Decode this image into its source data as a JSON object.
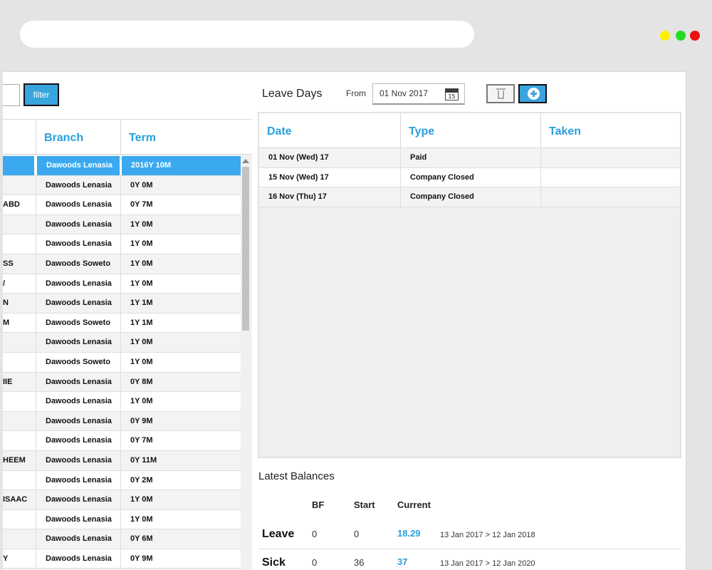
{
  "window": {
    "controls": [
      "minimize",
      "maximize",
      "close"
    ]
  },
  "filter": {
    "button_label": "filter",
    "search_value": ""
  },
  "employee_grid": {
    "headers": [
      "",
      "Branch",
      "Term"
    ],
    "rows": [
      {
        "name": "",
        "branch": "Dawoods Lenasia",
        "term": "2016Y 10M",
        "selected": true
      },
      {
        "name": "",
        "branch": "Dawoods Lenasia",
        "term": "0Y 0M"
      },
      {
        "name": "ABD",
        "branch": "Dawoods Lenasia",
        "term": "0Y 7M"
      },
      {
        "name": "",
        "branch": "Dawoods Lenasia",
        "term": "1Y 0M"
      },
      {
        "name": "",
        "branch": "Dawoods Lenasia",
        "term": "1Y 0M"
      },
      {
        "name": "SS",
        "branch": "Dawoods Soweto",
        "term": "1Y 0M"
      },
      {
        "name": "/",
        "branch": "Dawoods Lenasia",
        "term": "1Y 0M"
      },
      {
        "name": "N",
        "branch": "Dawoods Lenasia",
        "term": "1Y 1M"
      },
      {
        "name": "M",
        "branch": "Dawoods Soweto",
        "term": "1Y 1M"
      },
      {
        "name": "",
        "branch": "Dawoods Lenasia",
        "term": "1Y 0M"
      },
      {
        "name": "",
        "branch": "Dawoods Soweto",
        "term": "1Y 0M"
      },
      {
        "name": "IIE",
        "branch": "Dawoods Lenasia",
        "term": "0Y 8M"
      },
      {
        "name": "",
        "branch": "Dawoods Lenasia",
        "term": "1Y 0M"
      },
      {
        "name": "",
        "branch": "Dawoods Lenasia",
        "term": "0Y 9M"
      },
      {
        "name": "",
        "branch": "Dawoods Lenasia",
        "term": "0Y 7M"
      },
      {
        "name": "HEEM",
        "branch": "Dawoods Lenasia",
        "term": "0Y 11M"
      },
      {
        "name": "",
        "branch": "Dawoods Lenasia",
        "term": "0Y 2M"
      },
      {
        "name": "ISAAC",
        "branch": "Dawoods Lenasia",
        "term": "1Y 0M"
      },
      {
        "name": "",
        "branch": "Dawoods Lenasia",
        "term": "1Y 0M"
      },
      {
        "name": "",
        "branch": "Dawoods Lenasia",
        "term": "0Y 6M"
      },
      {
        "name": "Y",
        "branch": "Dawoods Lenasia",
        "term": "0Y 9M"
      }
    ]
  },
  "leave_days": {
    "title": "Leave Days",
    "from_label": "From",
    "from_value": "01 Nov 2017",
    "calendar_day": "15",
    "headers": [
      "Date",
      "Type",
      "Taken"
    ],
    "rows": [
      {
        "date": "01 Nov (Wed) 17",
        "type": "Paid",
        "taken": ""
      },
      {
        "date": "15 Nov (Wed) 17",
        "type": "Company Closed",
        "taken": ""
      },
      {
        "date": "16 Nov (Thu) 17",
        "type": "Company Closed",
        "taken": ""
      }
    ]
  },
  "balances": {
    "title": "Latest Balances",
    "headers": [
      "BF",
      "Start",
      "Current"
    ],
    "rows": [
      {
        "label": "Leave",
        "bf": "0",
        "start": "0",
        "current": "18.29",
        "range": "13 Jan 2017 > 12 Jan 2018"
      },
      {
        "label": "Sick",
        "bf": "0",
        "start": "36",
        "current": "37",
        "range": "13 Jan 2017 > 12 Jan 2020"
      }
    ]
  },
  "colors": {
    "accent": "#39a5de",
    "header_text": "#2a9fdc",
    "selection": "#3aa9f0"
  }
}
